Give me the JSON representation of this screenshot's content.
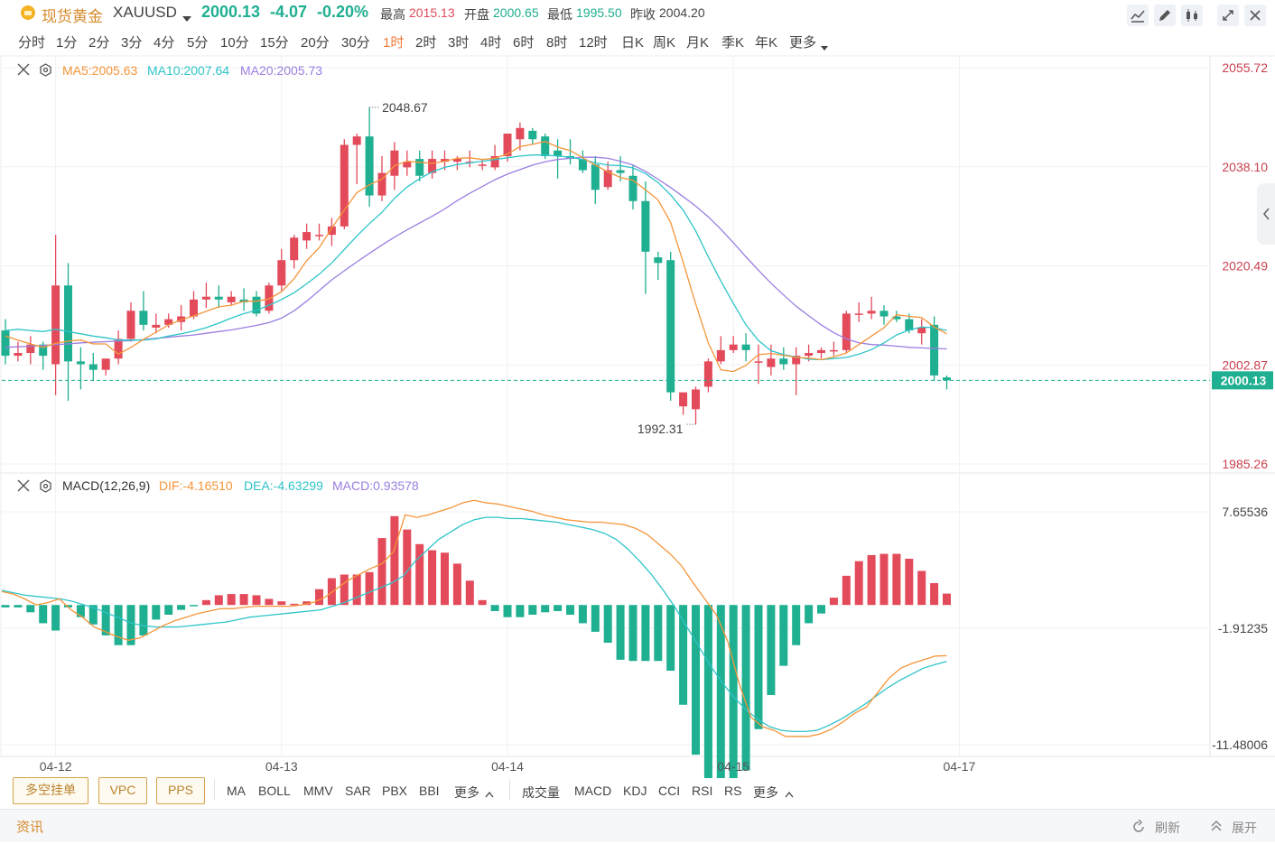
{
  "header": {
    "symbol_name": "现货黄金",
    "symbol_code": "XAUUSD",
    "last_price": "2000.13",
    "change": "-4.07",
    "change_pct": "-0.20%",
    "high_label": "最高",
    "high_value": "2015.13",
    "open_label": "开盘",
    "open_value": "2000.65",
    "low_label": "最低",
    "low_value": "1995.50",
    "prev_close_label": "昨收",
    "prev_close_value": "2004.20"
  },
  "timeframes": [
    "分时",
    "1分",
    "2分",
    "3分",
    "4分",
    "5分",
    "10分",
    "15分",
    "20分",
    "30分",
    "1时",
    "2时",
    "3时",
    "4时",
    "6时",
    "8时",
    "12时",
    "日K",
    "周K",
    "月K",
    "季K",
    "年K",
    "更多"
  ],
  "active_timeframe": "1时",
  "toolbar_icons": [
    "draw-line-icon",
    "pencil-icon",
    "candle-style-icon",
    "fullscreen-icon",
    "close-icon"
  ],
  "colors": {
    "up": "#e34b5b",
    "down": "#1faf91",
    "ma5": "#f5953a",
    "ma10": "#2ec4c9",
    "ma20": "#9b7ee0",
    "dif": "#f5953a",
    "dea": "#2ec4c9",
    "accent": "#f07a3a"
  },
  "main_legend": {
    "ma5": "MA5:2005.63",
    "ma10": "MA10:2007.64",
    "ma20": "MA20:2005.73"
  },
  "macd_legend": {
    "name": "MACD(12,26,9)",
    "dif": "DIF:-4.16510",
    "dea": "DEA:-4.63299",
    "macd": "MACD:0.93578"
  },
  "annotations": {
    "high_mark": "2048.67",
    "low_mark": "1992.31",
    "price_tag": "2000.13"
  },
  "indicators_left": [
    "多空挂单",
    "VPC",
    "PPS"
  ],
  "indicators_main": [
    "MA",
    "BOLL",
    "MMV",
    "SAR",
    "PBX",
    "BBI",
    "更多"
  ],
  "indicators_sub": [
    "成交量",
    "MACD",
    "KDJ",
    "CCI",
    "RSI",
    "RS",
    "更多"
  ],
  "info_bar": {
    "title": "资讯",
    "refresh": "刷新",
    "expand": "展开"
  },
  "chart_data": [
    {
      "type": "candlestick",
      "price_ticks": [
        "2055.72",
        "2038.10",
        "2020.49",
        "2002.87",
        "1985.26"
      ],
      "ylim": [
        1985.26,
        2055.72
      ],
      "x_ticks": [
        "04-12",
        "04-13",
        "04-14",
        "04-15",
        "04-17"
      ],
      "x_tick_index": [
        4,
        22,
        40,
        58,
        76
      ],
      "last_price_line": 2000.13,
      "candles": [
        {
          "o": 2009.0,
          "h": 2011.0,
          "c": 2004.5,
          "l": 2003.0
        },
        {
          "o": 2004.5,
          "h": 2007.0,
          "c": 2005.0,
          "l": 2003.5
        },
        {
          "o": 2005.0,
          "h": 2008.0,
          "c": 2006.5,
          "l": 2003.0
        },
        {
          "o": 2006.5,
          "h": 2007.0,
          "c": 2004.5,
          "l": 2002.0
        },
        {
          "o": 2003.0,
          "h": 2026.0,
          "c": 2017.0,
          "l": 1997.5
        },
        {
          "o": 2017.0,
          "h": 2021.0,
          "c": 2003.5,
          "l": 1996.5
        },
        {
          "o": 2003.5,
          "h": 2006.0,
          "c": 2003.0,
          "l": 1998.5
        },
        {
          "o": 2003.0,
          "h": 2005.0,
          "c": 2002.0,
          "l": 2000.0
        },
        {
          "o": 2002.0,
          "h": 2004.0,
          "c": 2004.0,
          "l": 2001.0
        },
        {
          "o": 2004.0,
          "h": 2009.0,
          "c": 2007.5,
          "l": 2003.0
        },
        {
          "o": 2007.5,
          "h": 2014.0,
          "c": 2012.5,
          "l": 2007.0
        },
        {
          "o": 2012.5,
          "h": 2016.0,
          "c": 2010.0,
          "l": 2009.0
        },
        {
          "o": 2009.5,
          "h": 2012.0,
          "c": 2010.0,
          "l": 2008.5
        },
        {
          "o": 2010.0,
          "h": 2012.0,
          "c": 2011.0,
          "l": 2009.5
        },
        {
          "o": 2010.5,
          "h": 2013.5,
          "c": 2011.5,
          "l": 2009.0
        },
        {
          "o": 2011.5,
          "h": 2016.0,
          "c": 2014.5,
          "l": 2011.0
        },
        {
          "o": 2014.5,
          "h": 2017.5,
          "c": 2015.0,
          "l": 2013.0
        },
        {
          "o": 2015.0,
          "h": 2017.0,
          "c": 2014.5,
          "l": 2013.0
        },
        {
          "o": 2014.0,
          "h": 2016.0,
          "c": 2015.0,
          "l": 2013.5
        },
        {
          "o": 2014.5,
          "h": 2016.5,
          "c": 2014.0,
          "l": 2012.5
        },
        {
          "o": 2015.0,
          "h": 2016.0,
          "c": 2012.0,
          "l": 2011.5
        },
        {
          "o": 2012.5,
          "h": 2017.5,
          "c": 2017.0,
          "l": 2012.0
        },
        {
          "o": 2017.0,
          "h": 2023.5,
          "c": 2021.5,
          "l": 2016.0
        },
        {
          "o": 2021.5,
          "h": 2026.0,
          "c": 2025.5,
          "l": 2020.0
        },
        {
          "o": 2025.0,
          "h": 2028.0,
          "c": 2026.5,
          "l": 2023.5
        },
        {
          "o": 2026.0,
          "h": 2028.0,
          "c": 2026.0,
          "l": 2025.0
        },
        {
          "o": 2026.0,
          "h": 2029.0,
          "c": 2027.5,
          "l": 2024.0
        },
        {
          "o": 2027.5,
          "h": 2043.0,
          "c": 2042.0,
          "l": 2027.0
        },
        {
          "o": 2042.0,
          "h": 2044.0,
          "c": 2043.5,
          "l": 2035.0
        },
        {
          "o": 2043.5,
          "h": 2048.67,
          "c": 2033.0,
          "l": 2031.0
        },
        {
          "o": 2033.0,
          "h": 2040.0,
          "c": 2037.0,
          "l": 2032.0
        },
        {
          "o": 2036.5,
          "h": 2042.5,
          "c": 2041.0,
          "l": 2034.0
        },
        {
          "o": 2038.0,
          "h": 2041.0,
          "c": 2039.0,
          "l": 2036.5
        },
        {
          "o": 2039.5,
          "h": 2041.0,
          "c": 2036.5,
          "l": 2035.5
        },
        {
          "o": 2037.0,
          "h": 2041.0,
          "c": 2039.5,
          "l": 2036.0
        },
        {
          "o": 2039.0,
          "h": 2041.0,
          "c": 2039.5,
          "l": 2037.5
        },
        {
          "o": 2039.0,
          "h": 2040.0,
          "c": 2039.5,
          "l": 2037.5
        },
        {
          "o": 2039.0,
          "h": 2041.0,
          "c": 2039.0,
          "l": 2038.0
        },
        {
          "o": 2038.5,
          "h": 2039.5,
          "c": 2038.5,
          "l": 2037.5
        },
        {
          "o": 2038.0,
          "h": 2042.0,
          "c": 2040.0,
          "l": 2037.5
        },
        {
          "o": 2040.0,
          "h": 2044.0,
          "c": 2044.0,
          "l": 2039.0
        },
        {
          "o": 2043.0,
          "h": 2046.0,
          "c": 2045.0,
          "l": 2041.0
        },
        {
          "o": 2044.5,
          "h": 2045.0,
          "c": 2043.0,
          "l": 2042.0
        },
        {
          "o": 2043.5,
          "h": 2044.0,
          "c": 2040.0,
          "l": 2039.5
        },
        {
          "o": 2041.0,
          "h": 2043.0,
          "c": 2040.0,
          "l": 2036.0
        },
        {
          "o": 2040.0,
          "h": 2043.0,
          "c": 2039.5,
          "l": 2038.5
        },
        {
          "o": 2039.5,
          "h": 2041.0,
          "c": 2037.5,
          "l": 2037.0
        },
        {
          "o": 2038.5,
          "h": 2040.0,
          "c": 2034.0,
          "l": 2031.5
        },
        {
          "o": 2034.5,
          "h": 2039.0,
          "c": 2037.5,
          "l": 2034.0
        },
        {
          "o": 2037.5,
          "h": 2040.0,
          "c": 2037.0,
          "l": 2035.5
        },
        {
          "o": 2036.5,
          "h": 2038.5,
          "c": 2032.0,
          "l": 2030.5
        },
        {
          "o": 2032.0,
          "h": 2035.5,
          "c": 2023.0,
          "l": 2015.5
        },
        {
          "o": 2022.0,
          "h": 2023.0,
          "c": 2021.0,
          "l": 2018.0
        },
        {
          "o": 2021.5,
          "h": 2023.0,
          "c": 1998.0,
          "l": 1996.5
        },
        {
          "o": 1995.5,
          "h": 1997.5,
          "c": 1998.0,
          "l": 1994.0
        },
        {
          "o": 1995.0,
          "h": 1999.0,
          "c": 1998.5,
          "l": 1992.31
        },
        {
          "o": 1999.0,
          "h": 2004.0,
          "c": 2003.5,
          "l": 1998.0
        },
        {
          "o": 2003.5,
          "h": 2008.0,
          "c": 2005.5,
          "l": 2003.0
        },
        {
          "o": 2005.5,
          "h": 2008.0,
          "c": 2006.5,
          "l": 2005.0
        },
        {
          "o": 2006.5,
          "h": 2008.5,
          "c": 2005.5,
          "l": 2003.5
        },
        {
          "o": 2003.5,
          "h": 2006.5,
          "c": 2003.5,
          "l": 1999.5
        },
        {
          "o": 2002.5,
          "h": 2006.5,
          "c": 2004.0,
          "l": 2001.0
        },
        {
          "o": 2004.0,
          "h": 2006.0,
          "c": 2003.0,
          "l": 2002.0
        },
        {
          "o": 2003.0,
          "h": 2006.0,
          "c": 2004.5,
          "l": 1997.5
        },
        {
          "o": 2004.5,
          "h": 2006.5,
          "c": 2005.0,
          "l": 2003.5
        },
        {
          "o": 2005.0,
          "h": 2006.0,
          "c": 2005.5,
          "l": 2004.0
        },
        {
          "o": 2005.5,
          "h": 2007.0,
          "c": 2005.5,
          "l": 2004.5
        },
        {
          "o": 2005.5,
          "h": 2012.5,
          "c": 2012.0,
          "l": 2005.0
        },
        {
          "o": 2012.0,
          "h": 2014.0,
          "c": 2012.0,
          "l": 2010.5
        },
        {
          "o": 2012.0,
          "h": 2015.0,
          "c": 2012.5,
          "l": 2011.0
        },
        {
          "o": 2012.5,
          "h": 2013.5,
          "c": 2011.5,
          "l": 2010.0
        },
        {
          "o": 2011.5,
          "h": 2012.5,
          "c": 2011.0,
          "l": 2010.5
        },
        {
          "o": 2011.0,
          "h": 2012.0,
          "c": 2009.0,
          "l": 2008.5
        },
        {
          "o": 2008.5,
          "h": 2011.0,
          "c": 2009.5,
          "l": 2006.5
        },
        {
          "o": 2010.0,
          "h": 2011.5,
          "c": 2001.0,
          "l": 2000.0
        },
        {
          "o": 2000.65,
          "h": 2001.0,
          "c": 2000.13,
          "l": 1998.5
        }
      ],
      "ma5": [
        2008.0,
        2007.3,
        2006.6,
        2006.0,
        2006.7,
        2007.1,
        2007.3,
        2006.6,
        2006.6,
        2004.8,
        2006.0,
        2007.4,
        2008.7,
        2010.0,
        2010.9,
        2011.6,
        2012.4,
        2013.2,
        2013.5,
        2014.2,
        2014.2,
        2014.6,
        2015.9,
        2018.2,
        2021.4,
        2023.7,
        2027.2,
        2030.4,
        2033.5,
        2034.9,
        2035.9,
        2038.3,
        2039.1,
        2038.9,
        2038.7,
        2039.1,
        2039.6,
        2039.7,
        2039.4,
        2039.6,
        2040.4,
        2041.7,
        2042.1,
        2042.6,
        2041.6,
        2041.0,
        2039.7,
        2038.4,
        2037.2,
        2036.2,
        2035.7,
        2034.0,
        2032.2,
        2028.2,
        2021.1,
        2013.7,
        2006.8,
        2002.0,
        2001.7,
        2002.8,
        2004.7,
        2004.9,
        2004.6,
        2004.2,
        2004.1,
        2003.8,
        2004.3,
        2005.0,
        2006.5,
        2008.0,
        2009.5,
        2011.8,
        2011.5,
        2011.3,
        2009.6,
        2008.4
      ],
      "ma10": [
        2009.0,
        2009.2,
        2009.0,
        2008.8,
        2009.2,
        2008.8,
        2008.4,
        2008.0,
        2007.7,
        2007.3,
        2007.3,
        2007.3,
        2007.5,
        2008.0,
        2008.4,
        2008.9,
        2009.5,
        2010.3,
        2011.2,
        2012.0,
        2012.6,
        2013.5,
        2014.5,
        2015.7,
        2017.3,
        2019.0,
        2021.0,
        2023.4,
        2025.8,
        2028.0,
        2030.0,
        2032.5,
        2034.5,
        2036.0,
        2037.2,
        2038.0,
        2038.5,
        2038.8,
        2039.1,
        2039.4,
        2039.7,
        2040.0,
        2040.2,
        2040.2,
        2040.0,
        2039.8,
        2039.4,
        2038.8,
        2038.4,
        2038.3,
        2037.9,
        2036.9,
        2035.3,
        2033.1,
        2030.4,
        2026.7,
        2022.1,
        2017.8,
        2013.8,
        2010.0,
        2007.2,
        2005.4,
        2004.7,
        2004.3,
        2003.9,
        2003.8,
        2004.0,
        2004.2,
        2004.8,
        2005.6,
        2006.8,
        2008.2,
        2009.1,
        2009.6,
        2009.5,
        2009.0
      ],
      "ma20": [
        2006.0,
        2006.1,
        2006.2,
        2006.3,
        2006.5,
        2006.6,
        2006.8,
        2006.9,
        2007.0,
        2007.1,
        2007.2,
        2007.4,
        2007.6,
        2007.8,
        2008.0,
        2008.2,
        2008.5,
        2008.8,
        2009.1,
        2009.5,
        2009.9,
        2010.4,
        2011.2,
        2012.5,
        2014.2,
        2016.1,
        2018.0,
        2019.6,
        2021.2,
        2022.7,
        2024.2,
        2025.6,
        2026.9,
        2028.1,
        2029.3,
        2030.6,
        2032.1,
        2033.4,
        2034.6,
        2035.8,
        2036.8,
        2037.6,
        2038.4,
        2039.0,
        2039.4,
        2039.6,
        2039.8,
        2039.8,
        2039.6,
        2039.1,
        2038.4,
        2037.3,
        2035.9,
        2034.4,
        2032.8,
        2031.1,
        2029.2,
        2027.0,
        2024.6,
        2022.1,
        2019.7,
        2017.4,
        2015.3,
        2013.3,
        2011.6,
        2010.0,
        2008.6,
        2007.5,
        2006.8,
        2006.5,
        2006.4,
        2006.2,
        2006.0,
        2005.9,
        2005.8,
        2005.73
      ]
    },
    {
      "type": "macd",
      "y_ticks": [
        "7.65536",
        "-1.91235",
        "-11.48006"
      ],
      "ylim": [
        -11.48006,
        7.65536
      ],
      "dif": [
        1.1,
        0.9,
        0.5,
        0.0,
        0.2,
        0.5,
        -0.4,
        -1.0,
        -1.8,
        -2.2,
        -2.6,
        -2.9,
        -2.7,
        -2.2,
        -1.7,
        -1.3,
        -1.0,
        -0.7,
        -0.5,
        -0.3,
        -0.3,
        -0.2,
        -0.1,
        -0.1,
        -0.1,
        -0.1,
        0.0,
        0.2,
        0.6,
        1.3,
        2.0,
        2.5,
        3.0,
        3.4,
        4.4,
        7.4,
        7.2,
        7.4,
        7.7,
        8.0,
        8.4,
        8.6,
        8.4,
        8.3,
        8.1,
        7.9,
        7.7,
        7.4,
        7.2,
        7.0,
        6.9,
        6.8,
        6.8,
        6.7,
        6.6,
        6.3,
        5.8,
        5.0,
        4.2,
        3.2,
        1.8,
        0.5,
        -0.8,
        -3.0,
        -6.5,
        -9.2,
        -10.0,
        -10.3,
        -10.8,
        -10.8,
        -10.8,
        -10.6,
        -10.2,
        -9.6,
        -8.9,
        -8.4,
        -7.2,
        -6.0,
        -5.2,
        -4.8,
        -4.5,
        -4.2,
        -4.1651
      ],
      "dea": [
        1.2,
        1.0,
        0.8,
        0.7,
        0.6,
        0.5,
        0.3,
        0.0,
        -0.3,
        -0.7,
        -1.1,
        -1.5,
        -1.7,
        -1.8,
        -1.8,
        -1.8,
        -1.7,
        -1.6,
        -1.5,
        -1.4,
        -1.2,
        -1.0,
        -0.9,
        -0.8,
        -0.7,
        -0.6,
        -0.5,
        -0.4,
        -0.1,
        0.2,
        0.6,
        1.0,
        1.4,
        1.8,
        2.4,
        3.6,
        4.5,
        5.4,
        6.0,
        6.6,
        7.0,
        7.2,
        7.2,
        7.1,
        7.1,
        7.0,
        6.9,
        6.8,
        6.6,
        6.4,
        6.2,
        5.9,
        5.4,
        4.6,
        3.6,
        2.5,
        1.2,
        -0.2,
        -1.8,
        -3.4,
        -5.0,
        -6.4,
        -7.6,
        -8.6,
        -9.4,
        -10.0,
        -10.3,
        -10.4,
        -10.4,
        -10.3,
        -9.9,
        -9.4,
        -8.8,
        -8.2,
        -7.5,
        -6.8,
        -6.2,
        -5.7,
        -5.2,
        -4.9,
        -4.63299
      ],
      "macd": [
        -0.2,
        -0.2,
        -0.6,
        -1.5,
        -2.1,
        -0.2,
        -1.0,
        -1.6,
        -2.5,
        -3.3,
        -3.3,
        -2.5,
        -1.2,
        -0.8,
        -0.4,
        -0.1,
        0.4,
        0.8,
        0.9,
        0.9,
        0.8,
        0.5,
        0.3,
        0.1,
        0.3,
        1.3,
        2.2,
        2.5,
        2.5,
        2.7,
        5.5,
        7.3,
        6.2,
        5.0,
        4.5,
        4.3,
        3.4,
        2.0,
        0.4,
        -0.5,
        -1.0,
        -1.0,
        -0.8,
        -0.6,
        -0.5,
        -0.8,
        -1.5,
        -2.2,
        -3.1,
        -4.5,
        -4.6,
        -4.6,
        -4.6,
        -5.4,
        -8.2,
        -12.3,
        -15.3,
        -16.6,
        -15.7,
        -13.6,
        -10.2,
        -7.4,
        -5.0,
        -3.3,
        -1.5,
        -0.7,
        0.6,
        2.4,
        3.6,
        4.1,
        4.2,
        4.2,
        3.8,
        2.8,
        1.8,
        0.93578
      ]
    }
  ]
}
